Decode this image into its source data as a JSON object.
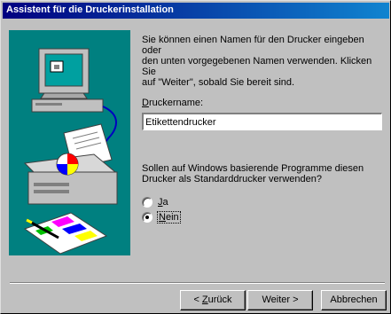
{
  "window": {
    "title": "Assistent für die Druckerinstallation"
  },
  "intro": {
    "text": "Sie können einen Namen für den Drucker eingeben oder\nden unten vorgegebenen Namen verwenden. Klicken Sie\nauf \"Weiter\", sobald Sie bereit sind."
  },
  "printer_name": {
    "label_first": "D",
    "label_rest": "ruckername:",
    "value": "Etikettendrucker"
  },
  "default_question": {
    "text": "Sollen auf Windows basierende Programme diesen\nDrucker als Standarddrucker verwenden?",
    "options": [
      {
        "first": "J",
        "rest": "a",
        "selected": false
      },
      {
        "first": "N",
        "rest": "ein",
        "selected": true
      }
    ]
  },
  "buttons": {
    "back_prefix": "< ",
    "back_first": "Z",
    "back_rest": "urück",
    "next": "Weiter >",
    "cancel": "Abbrechen"
  },
  "colors": {
    "title_start": "#000080",
    "title_end": "#1084d0",
    "art_bg": "#008080",
    "face": "#c0c0c0"
  }
}
